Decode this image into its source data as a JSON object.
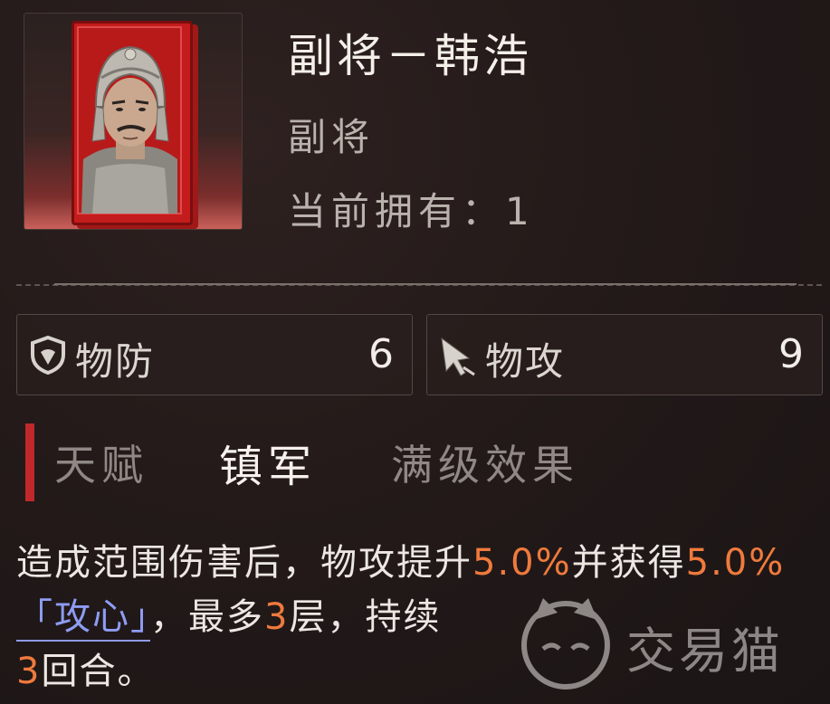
{
  "unit": {
    "name": "副将－韩浩",
    "rank": "副将",
    "owned_label": "当前拥有：",
    "owned_count": "1"
  },
  "stats": [
    {
      "label": "物防",
      "value": "6",
      "icon": "shield-icon"
    },
    {
      "label": "物攻",
      "value": "9",
      "icon": "sword-cursor-icon"
    }
  ],
  "talent": {
    "label": "天赋",
    "name": "镇军",
    "max_label": "满级效果",
    "accent_color": "#c0282b"
  },
  "description": {
    "part1": "造成范围伤害后，物攻提升",
    "val1": "5.0%",
    "part2": "并获得",
    "val2": "5.0%",
    "keyword": "「攻心」",
    "part3": "，最多",
    "val3": "3",
    "part4": "层，持续",
    "val4": "3",
    "part5": "回合。",
    "highlight_color": "#ef7a3d",
    "keyword_color": "#8e9cf2"
  },
  "watermark": {
    "text": "交易猫"
  }
}
